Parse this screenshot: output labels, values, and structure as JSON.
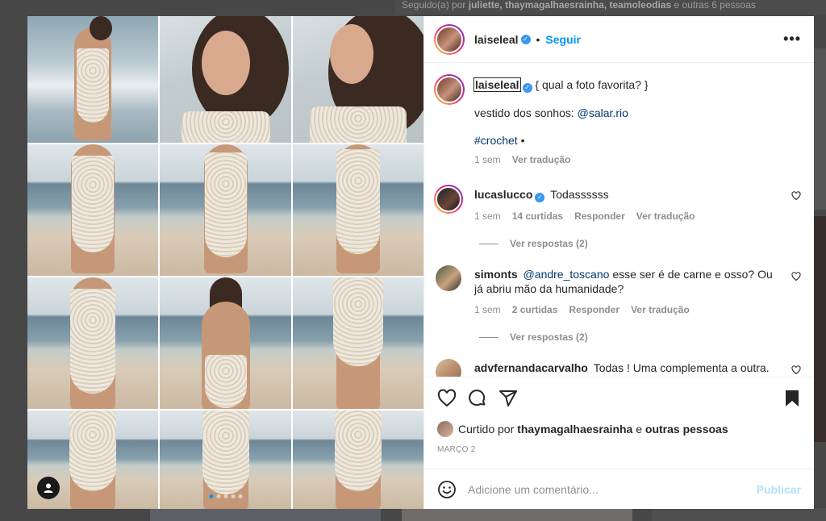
{
  "background": {
    "followed_prefix": "Seguido(a) por",
    "followed_users": "juliette, thaymagalhaesrainha, teamoleodias",
    "followed_suffix": "e outras 6 pessoas"
  },
  "post": {
    "author": "laiseleal",
    "separator": "•",
    "follow_label": "Seguir",
    "more_label": "•••",
    "media": {
      "carousel_dots": 5,
      "active_dot": 0
    },
    "caption": {
      "username": "laiseleal",
      "text": "{ qual a foto favorita? }",
      "line2_prefix": "vestido dos sonhos:",
      "line2_mention": "@salar.rio",
      "hashtag": "#crochet",
      "hashtag_suffix": "•",
      "time": "1 sem",
      "translate": "Ver tradução"
    },
    "comments": [
      {
        "username": "lucaslucco",
        "verified": true,
        "text": "Todassssss",
        "time": "1 sem",
        "likes": "14 curtidas",
        "reply": "Responder",
        "translate": "Ver tradução",
        "view_replies": "Ver respostas (2)"
      },
      {
        "username": "simonts",
        "verified": false,
        "mention": "@andre_toscano",
        "text": "esse ser é de carne e osso? Ou já abriu mão da humanidade?",
        "time": "1 sem",
        "likes": "2 curtidas",
        "reply": "Responder",
        "translate": "Ver tradução",
        "view_replies": "Ver respostas (2)"
      },
      {
        "username": "advfernandacarvalho",
        "verified": false,
        "text": "Todas ! Uma complementa a outra."
      }
    ],
    "liked_by_prefix": "Curtido por",
    "liked_by_user": "thaymagalhaesrainha",
    "liked_by_and": "e",
    "liked_by_others": "outras pessoas",
    "date": "MARÇO 2",
    "comment_placeholder": "Adicione um comentário...",
    "publish_label": "Publicar"
  },
  "colors": {
    "accent": "#0095f6",
    "verified": "#3897f0",
    "muted": "#8e8e8e",
    "text": "#262626"
  },
  "icons": [
    "verified-icon",
    "more-options-icon",
    "heart-icon",
    "comment-icon",
    "share-icon",
    "bookmark-icon",
    "emoji-icon",
    "next-arrow-icon",
    "user-tag-icon"
  ]
}
